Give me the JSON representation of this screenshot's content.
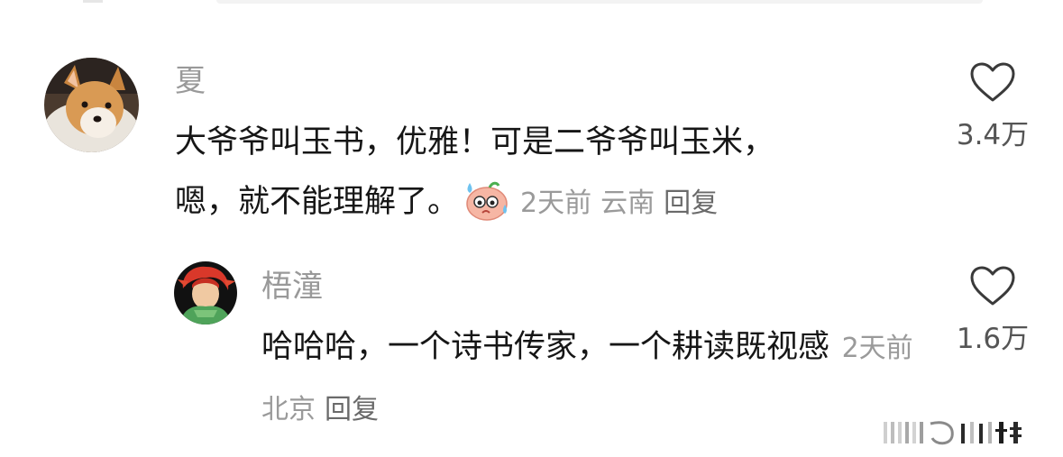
{
  "comment": {
    "username": "夏",
    "line1": "大爷爷叫玉书，优雅！可是二爷爷叫玉米，",
    "line2": "嗯，就不能理解了。",
    "emoji": "sweating-face-emoji",
    "time": "2天前",
    "location": "云南",
    "reply_label": "回复",
    "likes": "3.4万",
    "avatar": "corgi-avatar"
  },
  "reply": {
    "username": "梧潼",
    "text": "哈哈哈，一个诗书传家，一个耕读既视感",
    "time": "2天前",
    "location": "北京",
    "reply_label": "回复",
    "likes": "1.6万",
    "avatar": "red-hair-anime-avatar"
  },
  "colors": {
    "username": "#999999",
    "text": "#161616",
    "meta": "#9a9a9a",
    "like": "#555555"
  }
}
